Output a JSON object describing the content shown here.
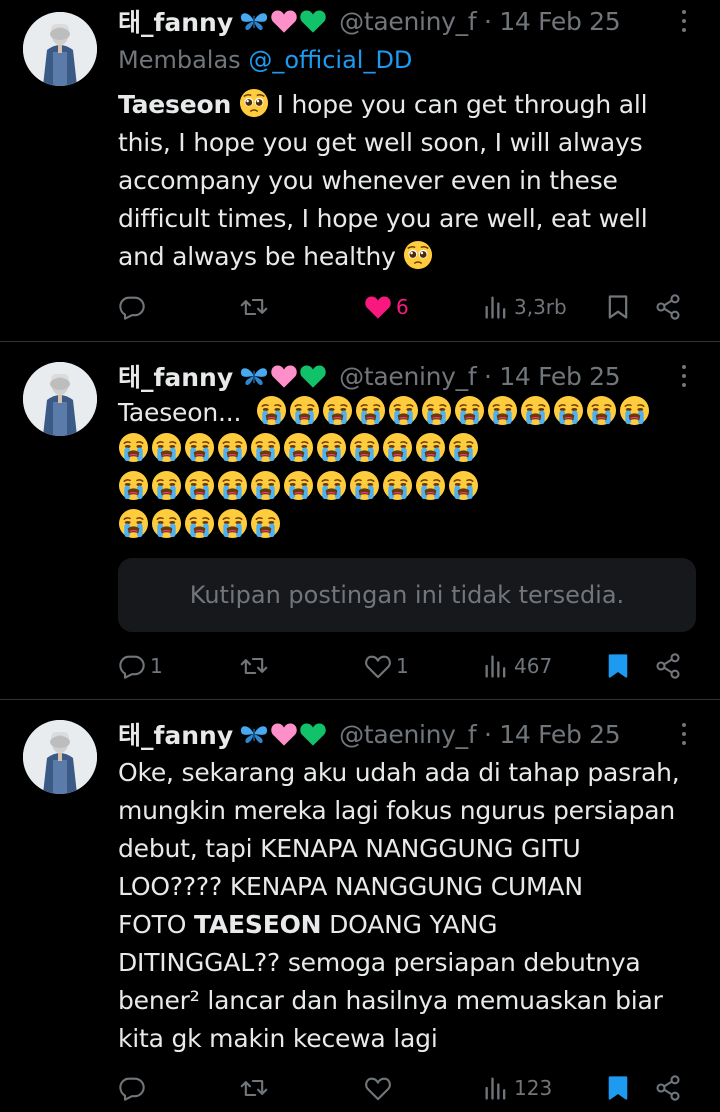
{
  "tweets": [
    {
      "name": "태_fanny",
      "handle": "@taeniny_f · 14 Feb 25",
      "reply_prefix": "Membalas ",
      "reply_to": "@_official_DD",
      "text_lead": "Taeseon",
      "text_mid": " I hope you can get through all this, I hope you get well soon, I will always accompany you whenever even in these difficult times, I hope you are well, eat well and always be healthy ",
      "stats": {
        "replies": "",
        "retweets": "",
        "likes": "6",
        "views": "3,3rb"
      },
      "liked": true,
      "bookmarked": false
    },
    {
      "name": "태_fanny",
      "handle": "@taeniny_f · 14 Feb 25",
      "text_lead": "Taeseon...",
      "cry_counts": [
        12,
        11,
        11,
        5
      ],
      "quote_text": "Kutipan postingan ini tidak tersedia.",
      "stats": {
        "replies": "1",
        "retweets": "",
        "likes": "1",
        "views": "467"
      },
      "liked": false,
      "bookmarked": true
    },
    {
      "name": "태_fanny",
      "handle": "@taeniny_f · 14 Feb 25",
      "text_lines": [
        "Oke, sekarang aku udah ada di tahap pasrah,",
        "mungkin mereka lagi fokus ngurus persiapan",
        "debut, tapi KENAPA NANGGUNG GITU",
        "LOO???? KENAPA NANGGUNG CUMAN",
        "FOTO ",
        "TAESEON",
        " DOANG YANG",
        "DITINGGAL?? semoga persiapan debutnya",
        "bener² lancar dan hasilnya memuaskan biar",
        "kita gk makin kecewa lagi"
      ],
      "stats": {
        "replies": "",
        "retweets": "",
        "likes": "",
        "views": "123"
      },
      "liked": false,
      "bookmarked": true
    }
  ],
  "colors": {
    "accent": "#1d9bf0",
    "like": "#f91880",
    "muted": "#71767b",
    "text": "#e7e9ea",
    "bg": "#000000"
  },
  "icons": [
    "reply-icon",
    "retweet-icon",
    "heart-icon",
    "views-icon",
    "bookmark-icon",
    "share-icon",
    "more-icon",
    "butterfly-emoji",
    "pink-heart-emoji",
    "green-heart-emoji",
    "pleading-face-emoji",
    "crying-face-emoji"
  ]
}
